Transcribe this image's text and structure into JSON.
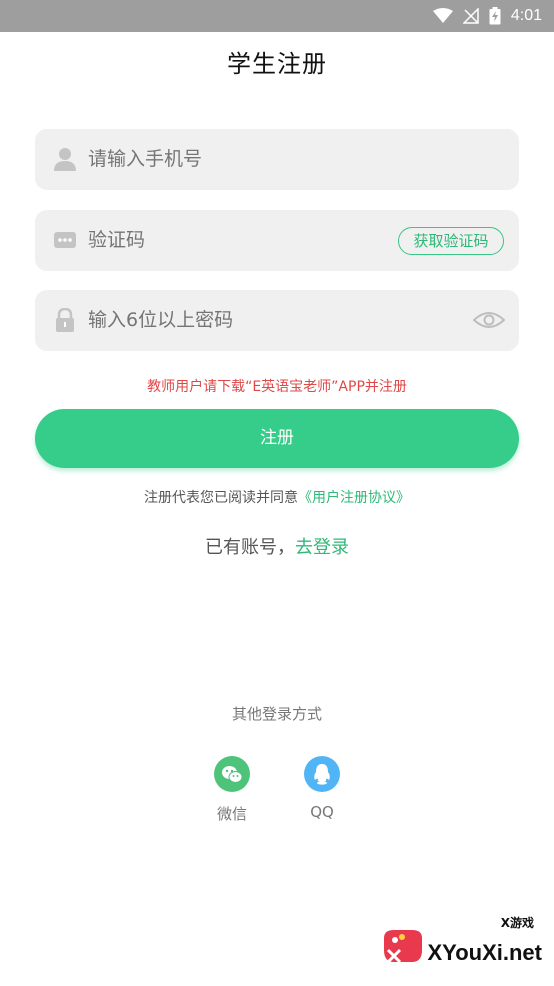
{
  "status_bar": {
    "time": "4:01"
  },
  "header": {
    "title": "学生注册"
  },
  "form": {
    "phone": {
      "placeholder": "请输入手机号",
      "icon": "user-icon"
    },
    "code": {
      "placeholder": "验证码",
      "icon": "message-icon",
      "get_code_label": "获取验证码"
    },
    "password": {
      "placeholder": "输入6位以上密码",
      "icon": "lock-icon",
      "toggle_icon": "eye-icon"
    }
  },
  "teacher_notice": "教师用户请下载“E英语宝老师”APP并注册",
  "register_button": "注册",
  "agreement": {
    "prefix": "注册代表您已阅读并同意",
    "link": "《用户注册协议》"
  },
  "login": {
    "prefix": "已有账号，",
    "link": "去登录"
  },
  "other_login": {
    "title": "其他登录方式",
    "options": [
      {
        "label": "微信",
        "icon": "wechat-icon",
        "color": "#4dc47a"
      },
      {
        "label": "QQ",
        "icon": "qq-icon",
        "color": "#51b5f5"
      }
    ]
  },
  "watermark": {
    "small_text": "X游戏",
    "text": "XYouXi.net"
  },
  "colors": {
    "accent": "#36cc8a",
    "notice": "#e04848",
    "field_bg": "#f0f0f0"
  }
}
